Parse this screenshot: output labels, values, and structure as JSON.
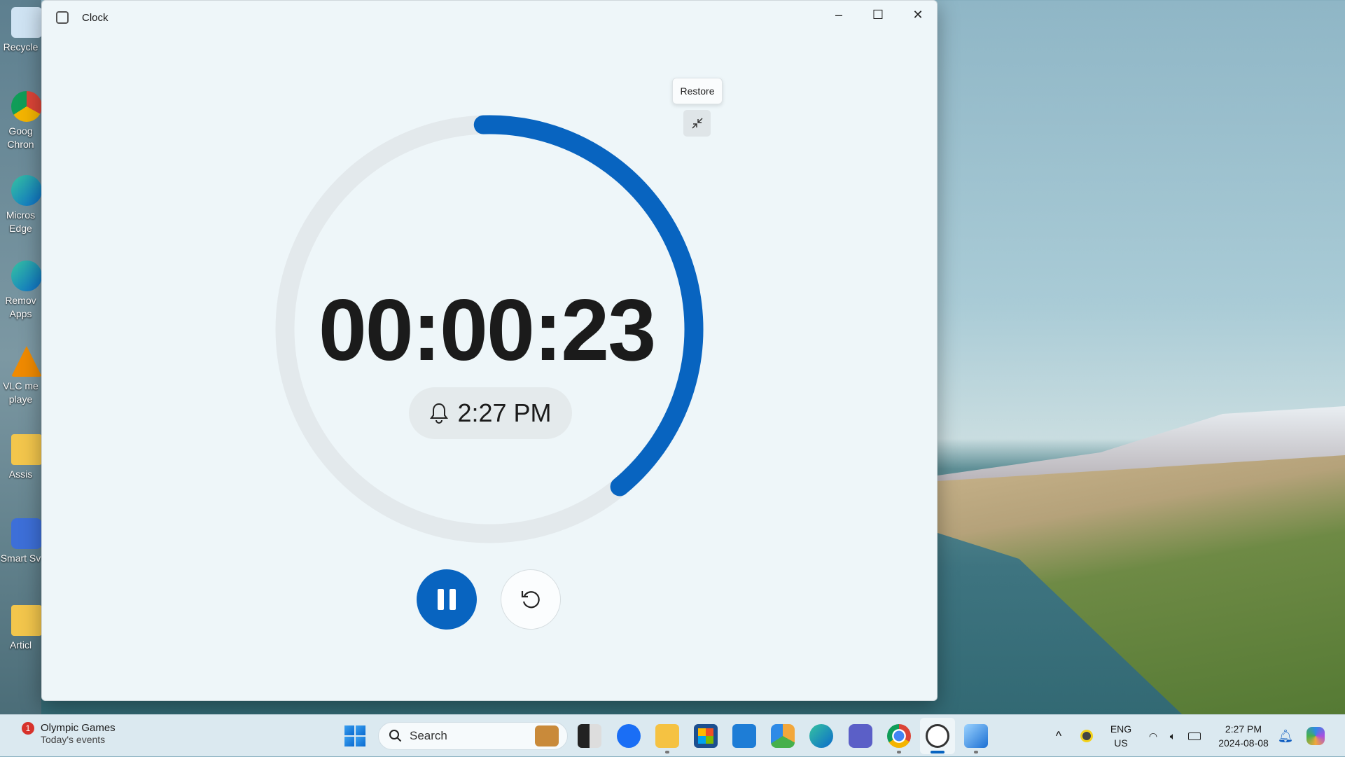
{
  "desktop": {
    "icons": [
      {
        "label": "Recycle"
      },
      {
        "label": "Goog Chron"
      },
      {
        "label": "Micros Edge"
      },
      {
        "label": "Remov Apps"
      },
      {
        "label": "VLC me playe"
      },
      {
        "label": "Assis"
      },
      {
        "label": "Smart Sv"
      },
      {
        "label": "Articl"
      }
    ]
  },
  "window": {
    "title": "Clock",
    "minimize": "–",
    "maximize": "☐",
    "close": "✕"
  },
  "timer": {
    "display": "00:00:23",
    "alarm_time": "2:27 PM",
    "progress_fraction": 0.39,
    "accent": "#0864c0",
    "track": "#e3e9ec"
  },
  "tooltip": {
    "text": "Restore"
  },
  "taskbar": {
    "widget": {
      "title": "Olympic Games",
      "subtitle": "Today's events",
      "badge": "1"
    },
    "search_placeholder": "Search",
    "apps": [
      "task-view",
      "zoom",
      "file-explorer",
      "microsoft-store",
      "office",
      "photos",
      "edge",
      "teams",
      "chrome",
      "clock",
      "paint"
    ],
    "tray": {
      "chevron": "^",
      "lang": "ENG",
      "region": "US",
      "time": "2:27 PM",
      "date": "2024-08-08"
    }
  }
}
